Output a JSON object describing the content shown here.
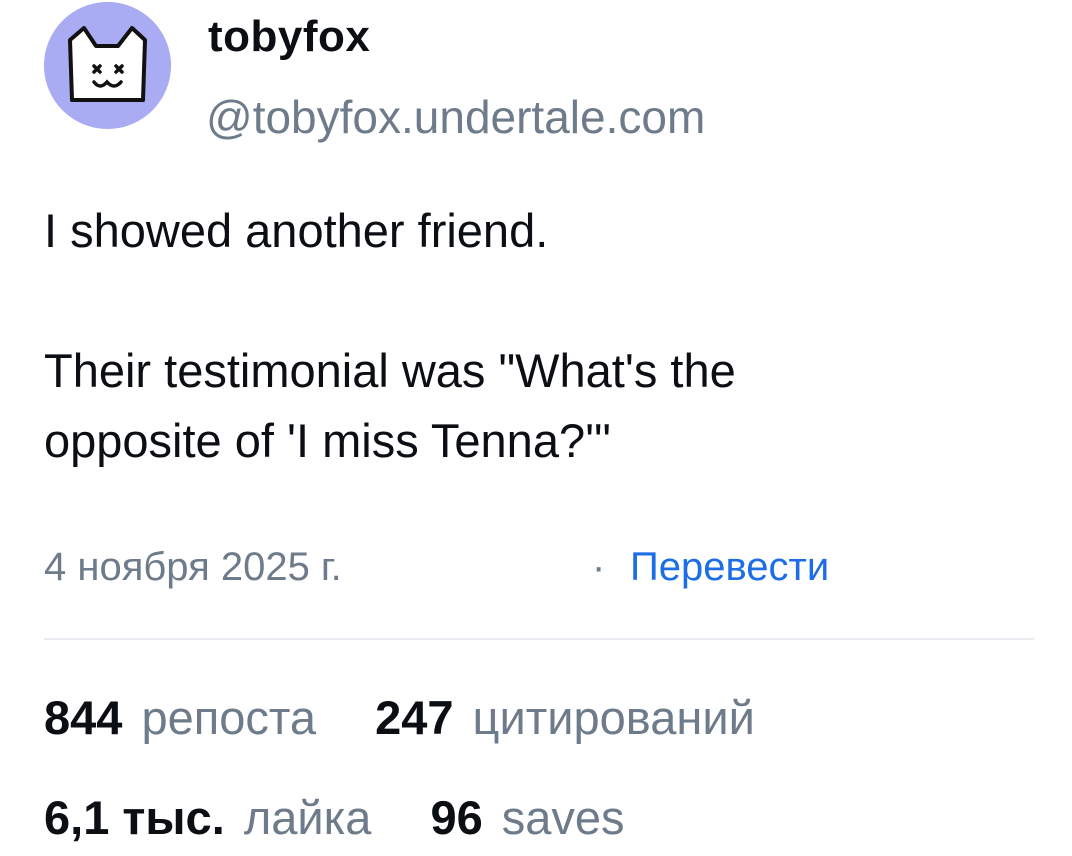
{
  "author": {
    "display_name": "tobyfox",
    "handle": "@tobyfox.undertale.com",
    "avatar_icon": "cat-face-avatar",
    "avatar_color": "#a9acf2"
  },
  "post": {
    "lines": [
      "I showed another friend.",
      "",
      "Their testimonial was \"What's the",
      "opposite of 'I miss Tenna?'\""
    ]
  },
  "meta": {
    "date": "4 ноября 2025 г.",
    "separator": "·",
    "translate_label": "Перевести",
    "link_color": "#1c6de6"
  },
  "stats": {
    "reposts": {
      "count": "844",
      "label": "репоста"
    },
    "quotes": {
      "count": "247",
      "label": "цитирований"
    },
    "likes": {
      "count": "6,1 тыс.",
      "label": "лайка"
    },
    "saves": {
      "count": "96",
      "label": "saves"
    }
  }
}
